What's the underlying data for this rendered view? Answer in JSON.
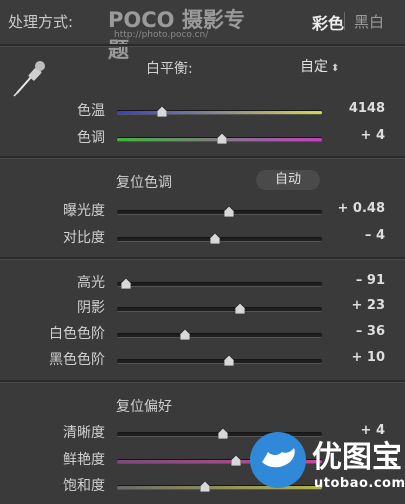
{
  "header": {
    "treatment_label": "处理方式:",
    "logo_brand": "POCO 摄影专题",
    "logo_url": "http://photo.poco.cn/",
    "mode_color": "彩色",
    "mode_bw": "黑白"
  },
  "white_balance": {
    "label": "白平衡:",
    "selected": "自定",
    "sliders": [
      {
        "label": "色温",
        "value_text": "4148",
        "position": 0.22
      },
      {
        "label": "色调",
        "value_text": "+ 4",
        "position": 0.51
      }
    ]
  },
  "tone": {
    "reset_label": "复位色调",
    "auto_label": "自动",
    "sliders": [
      {
        "label": "曝光度",
        "value_text": "+ 0.48",
        "position": 0.545
      },
      {
        "label": "对比度",
        "value_text": "– 4",
        "position": 0.48
      }
    ]
  },
  "presence_tone": {
    "sliders": [
      {
        "label": "高光",
        "value_text": "– 91",
        "position": 0.045
      },
      {
        "label": "阴影",
        "value_text": "+ 23",
        "position": 0.6
      },
      {
        "label": "白色色阶",
        "value_text": "– 36",
        "position": 0.33
      },
      {
        "label": "黑色色阶",
        "value_text": "+ 10",
        "position": 0.545
      }
    ]
  },
  "presence": {
    "reset_label": "复位偏好",
    "sliders": [
      {
        "label": "清晰度",
        "value_text": "+ 4",
        "position": 0.515
      },
      {
        "label": "鲜艳度",
        "value_text": "",
        "position": 0.58
      },
      {
        "label": "饱和度",
        "value_text": "",
        "position": 0.43
      }
    ]
  },
  "watermark": {
    "title": "优图宝",
    "url": "utobao.com"
  },
  "colors": {
    "temp_track": [
      "#3b3bd0",
      "#d8d84a"
    ],
    "tint_track": [
      "#3fb53f",
      "#c33fc3"
    ],
    "vibrance_track": [
      "#7a4a7a",
      "#c34a9a"
    ],
    "saturation_track": [
      "#6a6a6a",
      "#b5b54a"
    ],
    "watermark_blue": "#2f88d8"
  }
}
